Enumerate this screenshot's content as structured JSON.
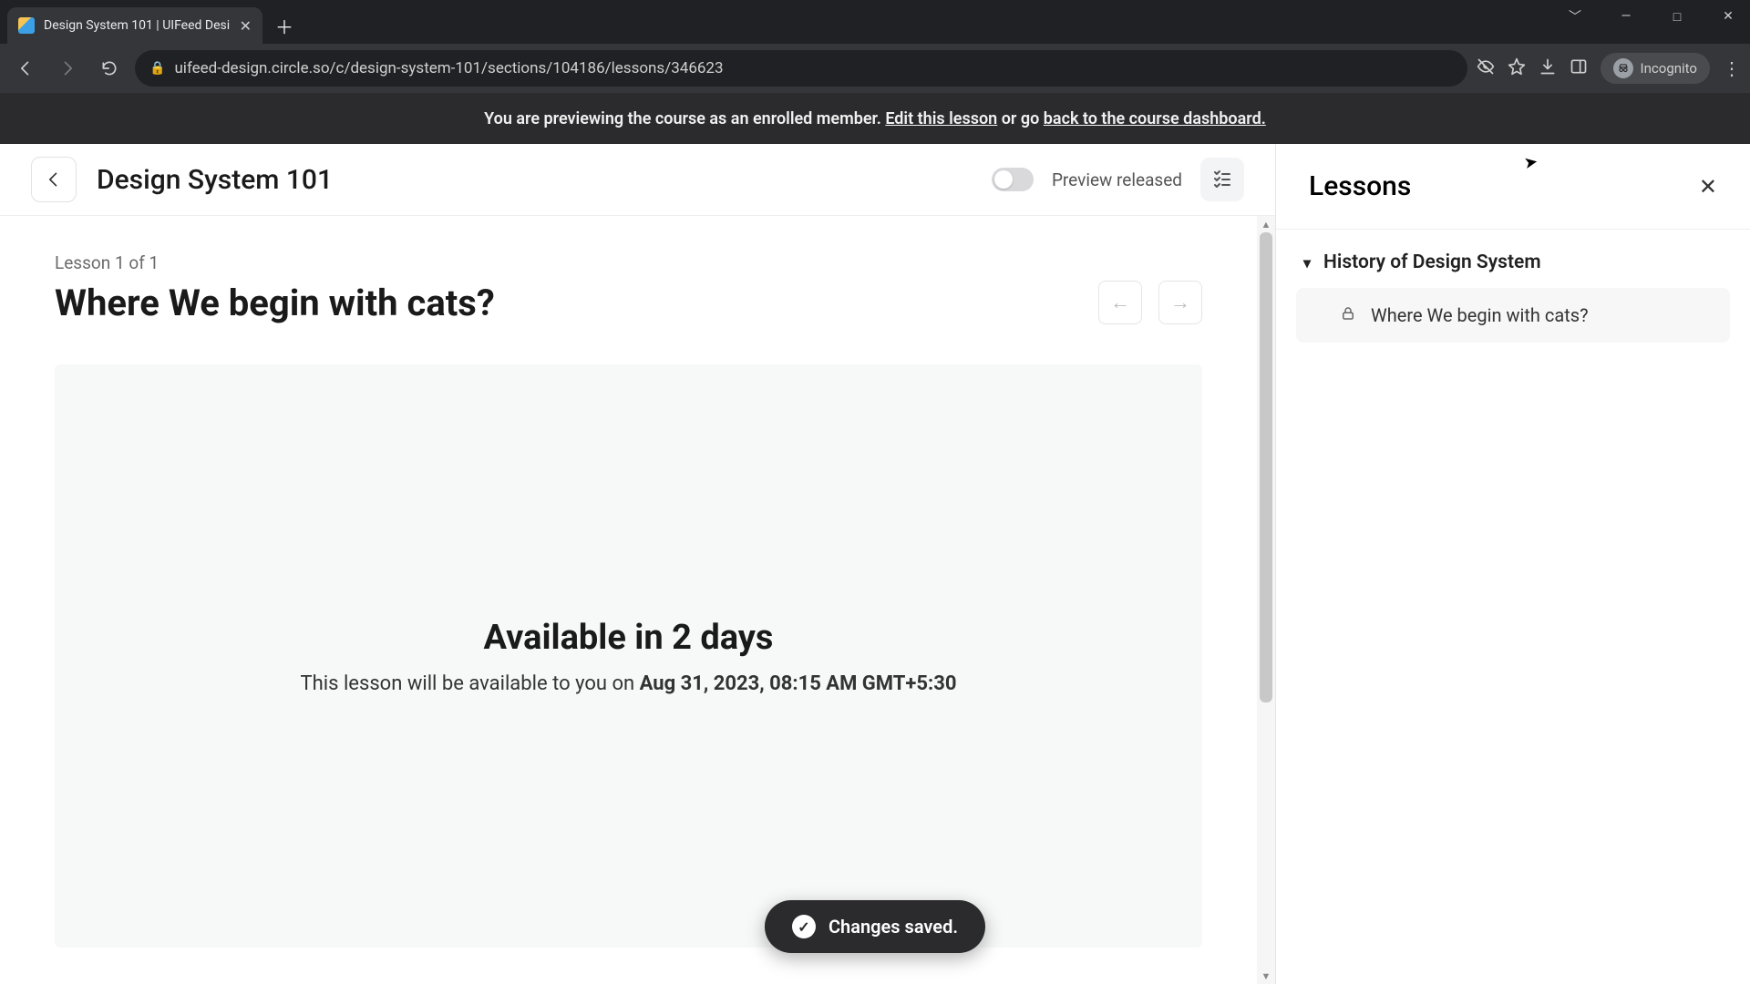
{
  "browser": {
    "tab_title": "Design System 101 | UIFeed Desi",
    "url": "uifeed-design.circle.so/c/design-system-101/sections/104186/lessons/346623",
    "incognito_label": "Incognito"
  },
  "banner": {
    "prefix": "You are previewing the course as an enrolled member. ",
    "edit_link": "Edit this lesson",
    "middle": " or go ",
    "back_link": "back to the course dashboard."
  },
  "header": {
    "course_title": "Design System 101",
    "toggle_label": "Preview released"
  },
  "lesson": {
    "meta": "Lesson 1 of 1",
    "title": "Where We begin with cats?",
    "locked_heading": "Available in 2 days",
    "locked_prefix": "This lesson will be available to you on ",
    "locked_datetime": "Aug 31, 2023, 08:15 AM GMT+5:30"
  },
  "sidepanel": {
    "title": "Lessons",
    "section_title": "History of Design System",
    "lesson_item": "Where We begin with cats?"
  },
  "toast": {
    "text": "Changes saved."
  }
}
